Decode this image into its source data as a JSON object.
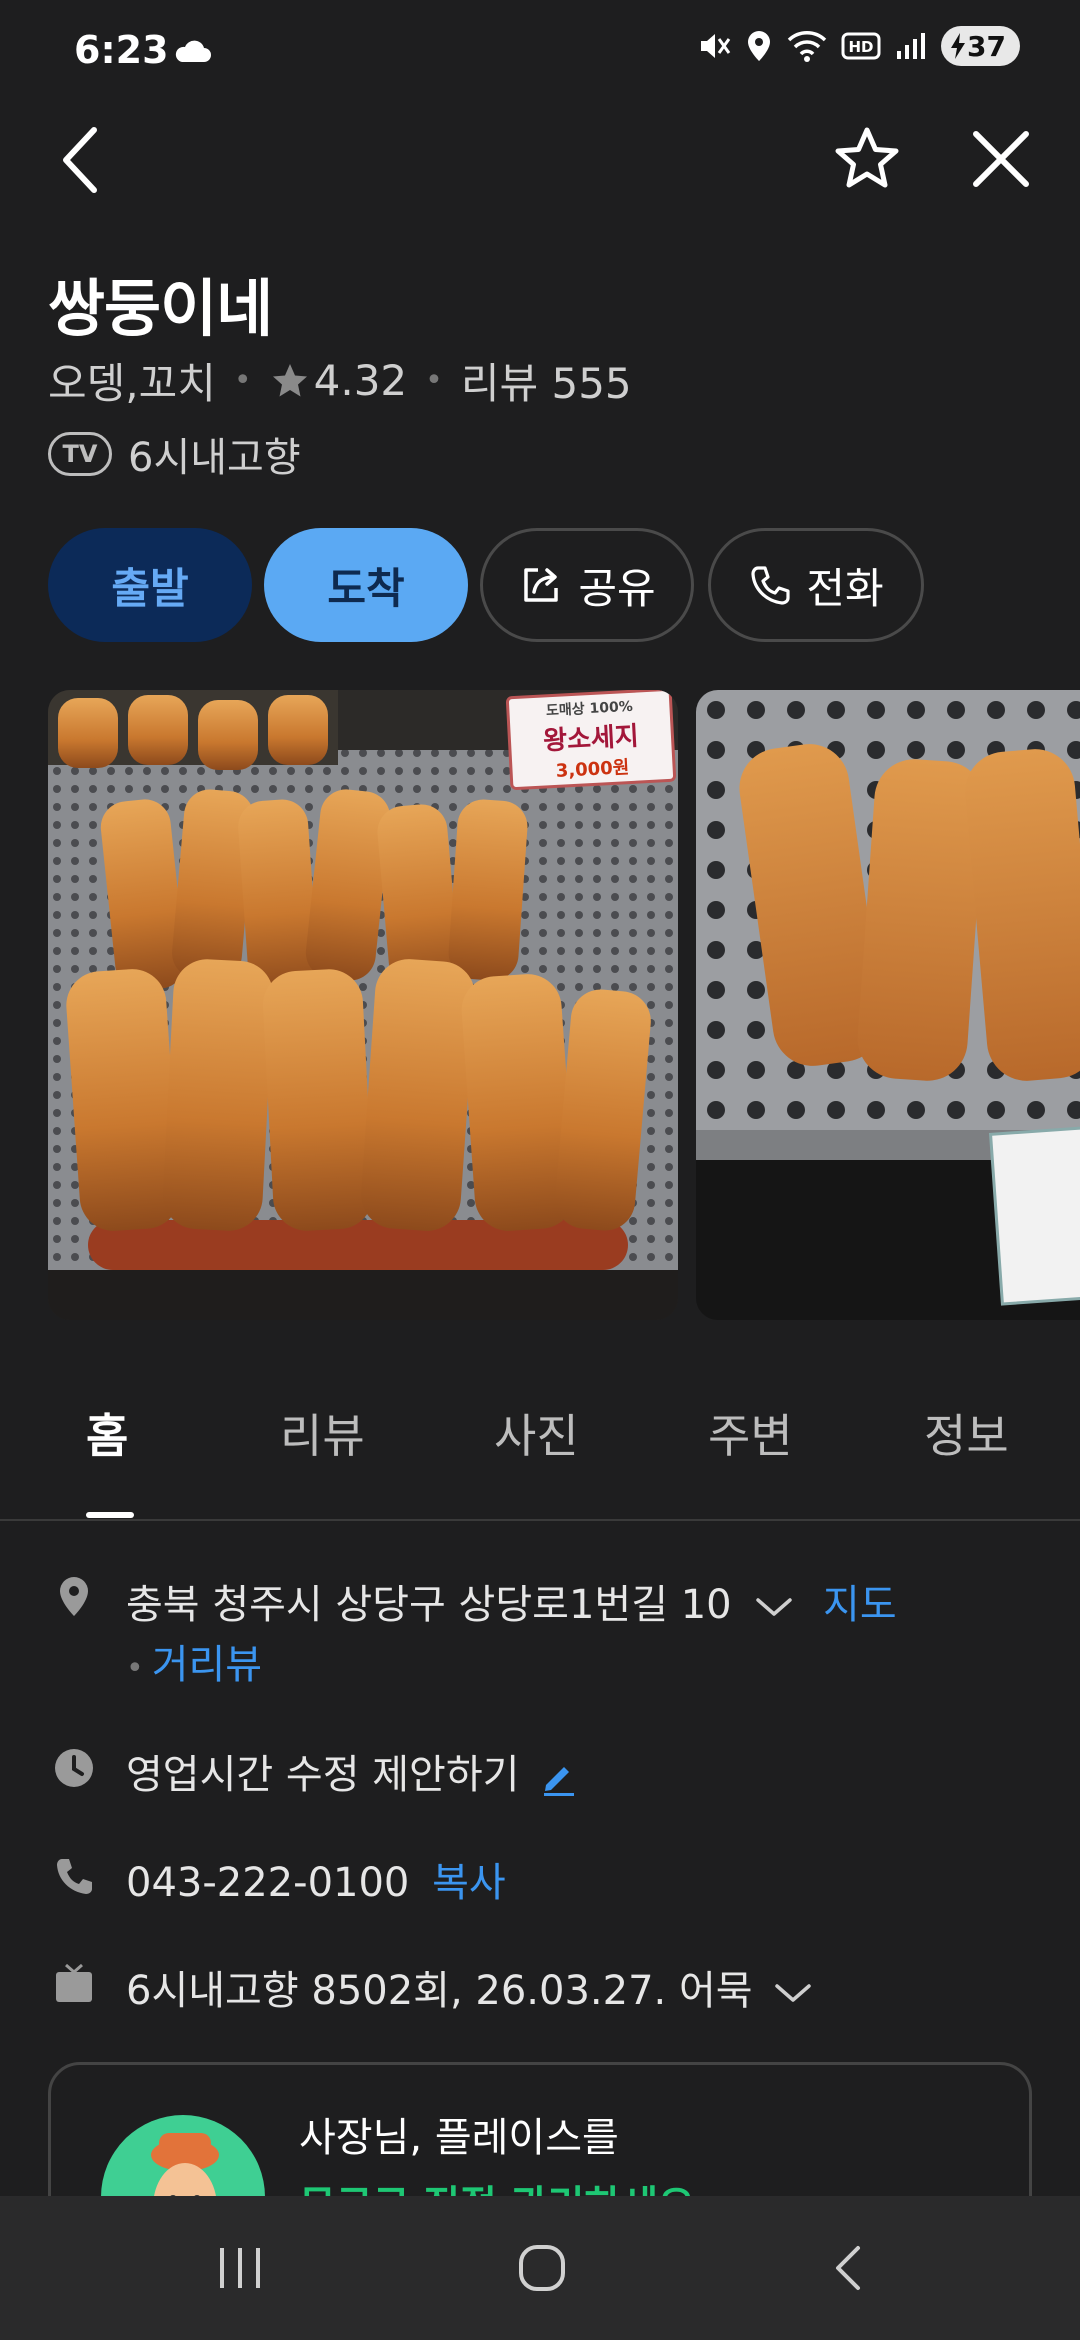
{
  "status_bar": {
    "time": "6:23",
    "battery": "37"
  },
  "header": {
    "back_icon": "chevron-left-icon",
    "favorite_icon": "star-outline-icon",
    "close_icon": "close-icon"
  },
  "place": {
    "name": "쌍둥이네",
    "category": "오뎅,꼬치",
    "rating": "4.32",
    "review_label": "리뷰 555",
    "tv_badge": "TV",
    "tv_show": "6시내고향"
  },
  "actions": {
    "depart": "출발",
    "arrive": "도착",
    "share": "공유",
    "call": "전화"
  },
  "photos": {
    "sign_top": "도매상 100%",
    "sign_main": "왕소세지",
    "sign_price": "3,000원"
  },
  "tabs": [
    "홈",
    "리뷰",
    "사진",
    "주변",
    "정보"
  ],
  "info": {
    "address": "충북 청주시 상당구 상당로1번길 10",
    "map_link": "지도",
    "street_view_link": "거리뷰",
    "hours_suggest": "영업시간 수정 제안하기",
    "phone": "043-222-0100",
    "copy_link": "복사",
    "tv_episode": "6시내고향 8502회, 26.03.27. 어묵"
  },
  "owner_card": {
    "title": "사장님, 플레이스를",
    "subtitle": "무료로 직접 관리하세요"
  },
  "colors": {
    "background": "#1e1e1f",
    "accent_blue": "#3b95f0",
    "arrive_bg": "#5ba9f3",
    "depart_bg": "#0c2a58",
    "green": "#1ec774"
  }
}
